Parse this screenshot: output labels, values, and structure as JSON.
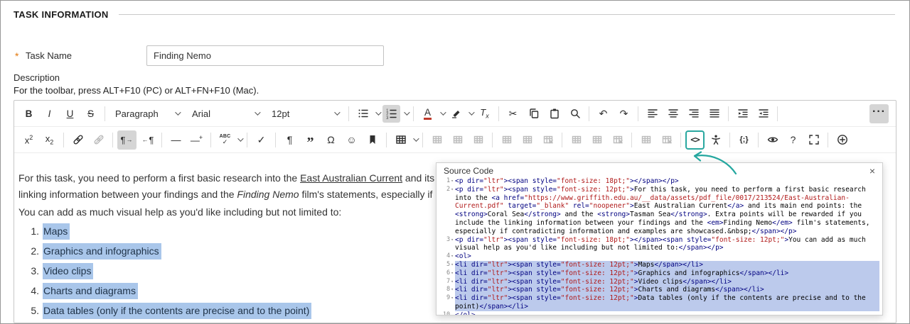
{
  "page": {
    "title": "TASK INFORMATION"
  },
  "form": {
    "required_marker": "*",
    "task_name": {
      "label": "Task Name",
      "value": "Finding Nemo"
    },
    "description_label": "Description",
    "toolbar_hint": "For the toolbar, press ALT+F10 (PC) or ALT+FN+F10 (Mac)."
  },
  "editor": {
    "toolbar_row1": [
      {
        "name": "bold-button",
        "label": "B",
        "cls": "b"
      },
      {
        "name": "italic-button",
        "label": "I",
        "cls": "i"
      },
      {
        "name": "underline-button",
        "label": "U",
        "cls": "u"
      },
      {
        "name": "strikethrough-button",
        "label": "S",
        "cls": "s"
      },
      {
        "type": "sep"
      },
      {
        "name": "paragraph-format-select",
        "type": "select",
        "label": "Paragraph",
        "caret": true
      },
      {
        "name": "font-family-select",
        "type": "select",
        "label": "Arial",
        "caret": true
      },
      {
        "name": "font-size-select",
        "type": "select",
        "label": "12pt",
        "caret": true
      },
      {
        "type": "sep"
      },
      {
        "name": "bullet-list-button",
        "icon": "list-ul",
        "caret": true
      },
      {
        "name": "numbered-list-button",
        "icon": "list-ol",
        "caret": true,
        "active": true
      },
      {
        "type": "sep"
      },
      {
        "name": "text-color-button",
        "icon": "text-color",
        "caret": true
      },
      {
        "name": "highlight-color-button",
        "icon": "highlighter",
        "caret": true
      },
      {
        "name": "clear-formatting-button",
        "icon": "clear-format"
      },
      {
        "type": "sep"
      },
      {
        "name": "cut-button",
        "icon": "scissors"
      },
      {
        "name": "copy-button",
        "icon": "copy"
      },
      {
        "name": "paste-button",
        "icon": "paste"
      },
      {
        "name": "search-button",
        "icon": "search"
      },
      {
        "type": "sep"
      },
      {
        "name": "undo-button",
        "icon": "undo"
      },
      {
        "name": "redo-button",
        "icon": "redo"
      },
      {
        "type": "sep"
      },
      {
        "name": "align-left-button",
        "icon": "align-left"
      },
      {
        "name": "align-center-button",
        "icon": "align-center"
      },
      {
        "name": "align-right-button",
        "icon": "align-right"
      },
      {
        "name": "justify-button",
        "icon": "align-justify"
      },
      {
        "type": "sep"
      },
      {
        "name": "indent-button",
        "icon": "indent"
      },
      {
        "name": "outdent-button",
        "icon": "outdent"
      },
      {
        "type": "sep"
      },
      {
        "name": "more-toolbar-button",
        "icon": "more",
        "active": true,
        "end": true
      }
    ],
    "toolbar_row2": [
      {
        "name": "superscript-button",
        "icon": "sup"
      },
      {
        "name": "subscript-button",
        "icon": "sub"
      },
      {
        "type": "sep"
      },
      {
        "name": "insert-link-button",
        "icon": "link"
      },
      {
        "name": "remove-link-button",
        "icon": "unlink",
        "disabled": true
      },
      {
        "type": "sep"
      },
      {
        "name": "ltr-button",
        "icon": "ltr",
        "active": true
      },
      {
        "name": "rtl-button",
        "icon": "rtl"
      },
      {
        "type": "sep"
      },
      {
        "name": "horizontal-rule-button",
        "icon": "hr"
      },
      {
        "name": "page-break-button",
        "icon": "page-break"
      },
      {
        "type": "sep"
      },
      {
        "name": "spellcheck-button",
        "icon": "spellcheck",
        "caret": true
      },
      {
        "type": "sep"
      },
      {
        "name": "accept-suggestion-button",
        "icon": "check"
      },
      {
        "type": "sep"
      },
      {
        "name": "show-invisibles-button",
        "icon": "pilcrow"
      },
      {
        "name": "blockquote-button",
        "icon": "quote"
      },
      {
        "name": "special-character-button",
        "icon": "omega"
      },
      {
        "name": "emoticons-button",
        "icon": "emoji"
      },
      {
        "name": "anchor-button",
        "icon": "bookmark"
      },
      {
        "type": "sep"
      },
      {
        "name": "table-button",
        "icon": "table",
        "caret": true
      },
      {
        "type": "sep"
      },
      {
        "name": "table-cell-properties-button",
        "icon": "table-op",
        "disabled": true
      },
      {
        "name": "table-merge-cells-button",
        "icon": "table-op",
        "disabled": true
      },
      {
        "name": "table-split-cell-button",
        "icon": "table-op",
        "disabled": true
      },
      {
        "type": "sep"
      },
      {
        "name": "table-insert-row-above-button",
        "icon": "table-op",
        "disabled": true
      },
      {
        "name": "table-insert-row-below-button",
        "icon": "table-op",
        "disabled": true
      },
      {
        "name": "table-delete-row-button",
        "icon": "table-op-del",
        "disabled": true
      },
      {
        "type": "sep"
      },
      {
        "name": "table-insert-col-before-button",
        "icon": "table-op",
        "disabled": true
      },
      {
        "name": "table-insert-col-after-button",
        "icon": "table-op",
        "disabled": true
      },
      {
        "name": "table-delete-col-button",
        "icon": "table-op-del",
        "disabled": true
      },
      {
        "type": "sep"
      },
      {
        "name": "table-properties-button",
        "icon": "table-op",
        "disabled": true
      },
      {
        "name": "table-delete-button",
        "icon": "table-op-del",
        "disabled": true
      },
      {
        "type": "sep"
      },
      {
        "name": "source-code-button",
        "icon": "source-code",
        "outlined": true
      },
      {
        "name": "accessibility-checker-button",
        "icon": "accessibility"
      },
      {
        "type": "sep"
      },
      {
        "name": "code-sample-button",
        "icon": "code-sample"
      },
      {
        "type": "sep"
      },
      {
        "name": "preview-button",
        "icon": "eye"
      },
      {
        "name": "help-button",
        "icon": "help"
      },
      {
        "name": "fullscreen-button",
        "icon": "fullscreen"
      },
      {
        "type": "sep"
      },
      {
        "name": "add-content-button",
        "icon": "plus-circle"
      }
    ],
    "content": {
      "paragraph1": [
        {
          "text": "For this task, you need to perform a first basic research into the "
        },
        {
          "text": "East Australian Current",
          "style": "link"
        },
        {
          "text": " and its main end points: the "
        },
        {
          "text": "Coral Sea",
          "style": "bold"
        },
        {
          "text": " and the "
        },
        {
          "text": "Tasman Sea",
          "style": "bold"
        },
        {
          "text": ". Extra points will be rewarded if you include the linking information between your findings and the "
        },
        {
          "text": "Finding Nemo",
          "style": "italic"
        },
        {
          "text": " film's statements, especially if contradicting information and examples are showcased."
        }
      ],
      "paragraph2": "You can add as much visual help as you'd like including but not limited to:",
      "list": [
        {
          "number": "1.",
          "text": "Maps"
        },
        {
          "number": "2.",
          "text": "Graphics and infographics"
        },
        {
          "number": "3.",
          "text": "Video clips"
        },
        {
          "number": "4.",
          "text": "Charts and diagrams"
        },
        {
          "number": "5.",
          "text": "Data tables (only if the contents are precise and to the point)"
        }
      ]
    }
  },
  "source_dialog": {
    "title": "Source Code",
    "close_label": "×",
    "lines": [
      {
        "n": 1,
        "fold": true,
        "selected": false,
        "code": "<p dir=\"ltr\"><span style=\"font-size: 18pt;\"></span></p>"
      },
      {
        "n": 2,
        "fold": true,
        "selected": false,
        "code": "<p dir=\"ltr\"><span style=\"font-size: 12pt;\">For this task, you need to perform a first basic research into the <a href=\"https://www.griffith.edu.au/__data/assets/pdf_file/0017/213524/East-Australian-Current.pdf\" target=\"_blank\" rel=\"noopener\">East Australian Current</a> and its main end points: the <strong>Coral Sea</strong> and the <strong>Tasman Sea</strong>. Extra points will be rewarded if you include the linking information between your findings and the <em>Finding Nemo</em> film's statements, especially if contradicting information and examples are showcased.&nbsp;</span></p>"
      },
      {
        "n": 3,
        "fold": true,
        "selected": false,
        "code": "<p dir=\"ltr\"><span style=\"font-size: 18pt;\"></span><span style=\"font-size: 12pt;\">You can add as much visual help as you'd like including but not limited to:</span></p>"
      },
      {
        "n": 4,
        "fold": true,
        "selected": false,
        "code": "<ol>"
      },
      {
        "n": 5,
        "fold": true,
        "selected": true,
        "code": "<li dir=\"ltr\"><span style=\"font-size: 12pt;\">Maps</span></li>"
      },
      {
        "n": 6,
        "fold": true,
        "selected": true,
        "code": "<li dir=\"ltr\"><span style=\"font-size: 12pt;\">Graphics and infographics</span></li>"
      },
      {
        "n": 7,
        "fold": true,
        "selected": true,
        "code": "<li dir=\"ltr\"><span style=\"font-size: 12pt;\">Video clips</span></li>"
      },
      {
        "n": 8,
        "fold": true,
        "selected": true,
        "code": "<li dir=\"ltr\"><span style=\"font-size: 12pt;\">Charts and diagrams</span></li>"
      },
      {
        "n": 9,
        "fold": true,
        "selected": true,
        "code": "<li dir=\"ltr\"><span style=\"font-size: 12pt;\">Data tables (only if the contents are precise and to the point)</span></li>"
      },
      {
        "n": 10,
        "fold": false,
        "selected": false,
        "code": "</ol>"
      }
    ]
  },
  "colors": {
    "accent_teal": "#2aa8a0",
    "selection_blue": "#a9c6ea",
    "code_selection_blue": "#bccaec",
    "required_marker_orange": "#e2780c",
    "code_tag_navy": "#000080",
    "code_string_red": "#b01919"
  }
}
